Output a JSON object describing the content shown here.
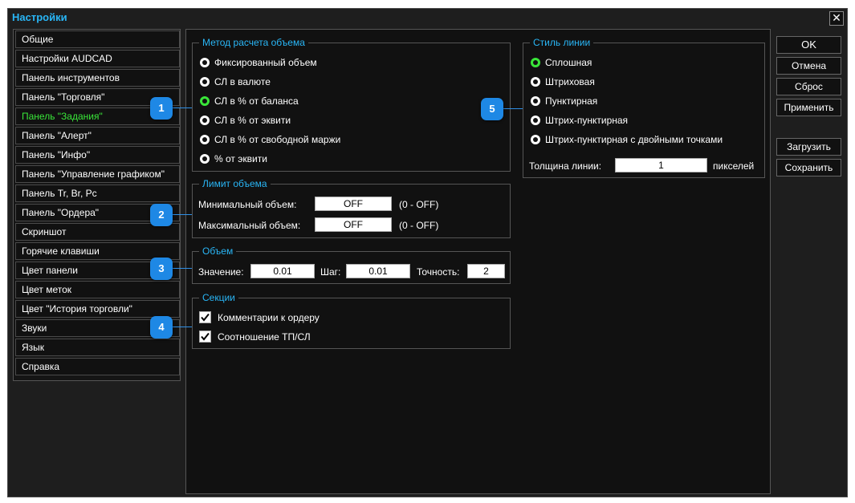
{
  "window": {
    "title": "Настройки",
    "close_glyph": "✕"
  },
  "sidebar": {
    "items": [
      {
        "label": "Общие"
      },
      {
        "label": "Настройки AUDCAD"
      },
      {
        "label": "Панель инструментов"
      },
      {
        "label": "Панель \"Торговля\""
      },
      {
        "label": "Панель \"Задания\"",
        "active": true
      },
      {
        "label": "Панель \"Алерт\""
      },
      {
        "label": "Панель \"Инфо\""
      },
      {
        "label": "Панель \"Управление графиком\""
      },
      {
        "label": "Панель Tr, Br, Pc"
      },
      {
        "label": "Панель \"Ордера\""
      },
      {
        "label": "Скриншот"
      },
      {
        "label": "Горячие клавиши"
      },
      {
        "label": "Цвет панели"
      },
      {
        "label": "Цвет меток"
      },
      {
        "label": "Цвет \"История торговли\""
      },
      {
        "label": "Звуки"
      },
      {
        "label": "Язык"
      },
      {
        "label": "Справка"
      }
    ]
  },
  "volume_method": {
    "title": "Метод расчета объема",
    "options": [
      {
        "label": "Фиксированный объем"
      },
      {
        "label": "СЛ в валюте"
      },
      {
        "label": "СЛ в % от баланса",
        "selected": true
      },
      {
        "label": "СЛ в % от эквити"
      },
      {
        "label": "СЛ в % от свободной маржи"
      },
      {
        "label": "% от эквити"
      }
    ]
  },
  "volume_limit": {
    "title": "Лимит объема",
    "min_label": "Минимальный объем:",
    "min_value": "OFF",
    "min_hint": "(0 - OFF)",
    "max_label": "Максимальный объем:",
    "max_value": "OFF",
    "max_hint": "(0 - OFF)"
  },
  "volume": {
    "title": "Объем",
    "value_label": "Значение:",
    "value": "0.01",
    "step_label": "Шаг:",
    "step": "0.01",
    "precision_label": "Точность:",
    "precision": "2"
  },
  "sections": {
    "title": "Секции",
    "items": [
      {
        "label": "Комментарии к ордеру",
        "checked": true
      },
      {
        "label": "Соотношение ТП/СЛ",
        "checked": true
      }
    ]
  },
  "line_style": {
    "title": "Стиль линии",
    "options": [
      {
        "label": "Сплошная",
        "selected": true
      },
      {
        "label": "Штриховая"
      },
      {
        "label": "Пунктирная"
      },
      {
        "label": "Штрих-пунктирная"
      },
      {
        "label": "Штрих-пунктирная с двойными точками"
      }
    ],
    "thickness_label": "Толщина линии:",
    "thickness_value": "1",
    "thickness_unit": "пикселей"
  },
  "buttons": {
    "ok": "OK",
    "cancel": "Отмена",
    "reset": "Сброс",
    "apply": "Применить",
    "load": "Загрузить",
    "save": "Сохранить"
  },
  "callouts": [
    "1",
    "2",
    "3",
    "4",
    "5"
  ],
  "colors": {
    "accent_title": "#29b6f6",
    "active_item": "#39e639",
    "callout": "#1e88e5",
    "selected_radio": "#39e639"
  }
}
